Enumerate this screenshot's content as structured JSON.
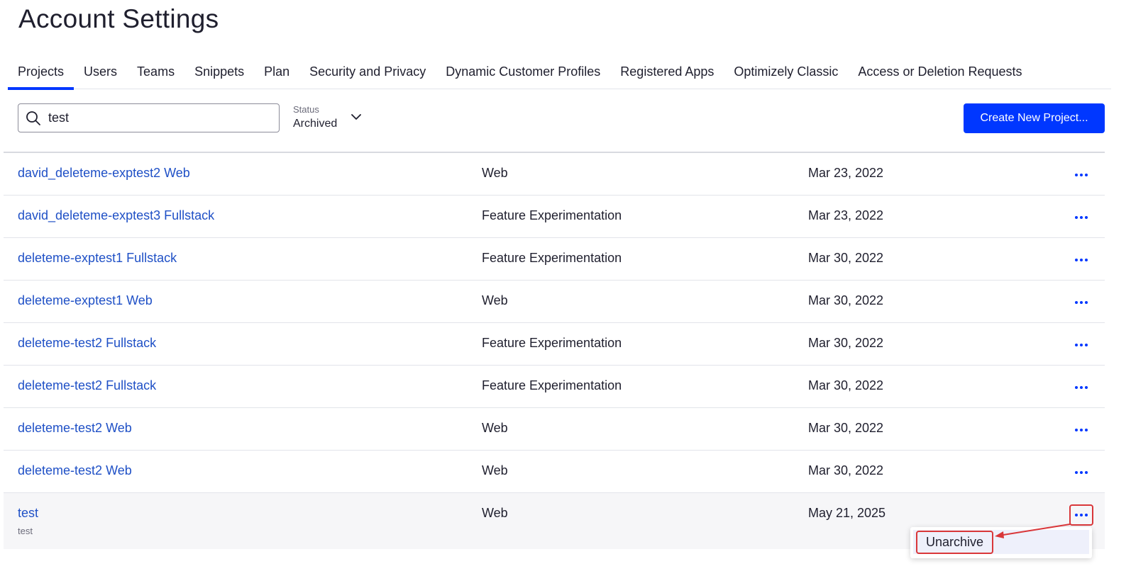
{
  "page": {
    "title": "Account Settings"
  },
  "tabs": [
    {
      "label": "Projects",
      "active": true
    },
    {
      "label": "Users"
    },
    {
      "label": "Teams"
    },
    {
      "label": "Snippets"
    },
    {
      "label": "Plan"
    },
    {
      "label": "Security and Privacy"
    },
    {
      "label": "Dynamic Customer Profiles"
    },
    {
      "label": "Registered Apps"
    },
    {
      "label": "Optimizely Classic"
    },
    {
      "label": "Access or Deletion Requests"
    }
  ],
  "search": {
    "value": "test",
    "icon": "search-icon"
  },
  "status_filter": {
    "label": "Status",
    "value": "Archived",
    "icon": "chevron-down-icon"
  },
  "create_button": {
    "label": "Create New Project..."
  },
  "projects": [
    {
      "name": "david_deleteme-exptest2 Web",
      "platform": "Web",
      "date": "Mar 23, 2022"
    },
    {
      "name": "david_deleteme-exptest3 Fullstack",
      "platform": "Feature Experimentation",
      "date": "Mar 23, 2022"
    },
    {
      "name": "deleteme-exptest1 Fullstack",
      "platform": "Feature Experimentation",
      "date": "Mar 30, 2022"
    },
    {
      "name": "deleteme-exptest1 Web",
      "platform": "Web",
      "date": "Mar 30, 2022"
    },
    {
      "name": "deleteme-test2 Fullstack",
      "platform": "Feature Experimentation",
      "date": "Mar 30, 2022"
    },
    {
      "name": "deleteme-test2 Fullstack",
      "platform": "Feature Experimentation",
      "date": "Mar 30, 2022"
    },
    {
      "name": "deleteme-test2 Web",
      "platform": "Web",
      "date": "Mar 30, 2022"
    },
    {
      "name": "deleteme-test2 Web",
      "platform": "Web",
      "date": "Mar 30, 2022"
    },
    {
      "name": "test",
      "description": "test",
      "platform": "Web",
      "date": "May 21, 2025"
    }
  ],
  "row_menu": {
    "icon": "more-horizontal-icon",
    "items": [
      {
        "label": "Unarchive"
      }
    ]
  },
  "colors": {
    "accent": "#0037ff",
    "link": "#1f50c6",
    "annotation": "#d9373a"
  }
}
